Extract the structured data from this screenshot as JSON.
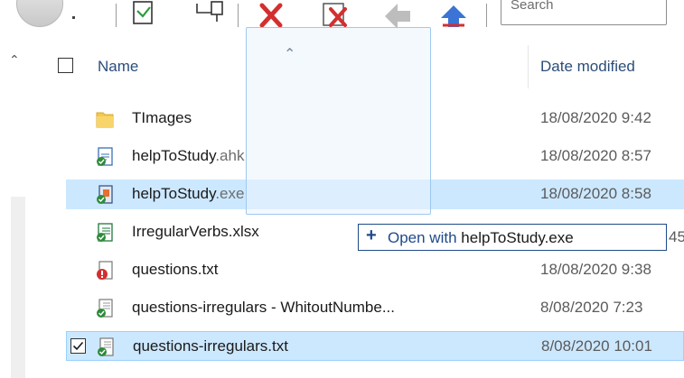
{
  "toolbar": {
    "search_placeholder": "Search",
    "icons": [
      "view-icon",
      "new-file-icon",
      "copy-icon",
      "delete-icon",
      "delete-red-icon",
      "back-icon",
      "forward-icon"
    ]
  },
  "columns": {
    "name": "Name",
    "date_modified": "Date modified"
  },
  "files": [
    {
      "name": "TImages",
      "ext": "",
      "date": "18/08/2020 9:42",
      "icon": "folder-icon",
      "state": "normal"
    },
    {
      "name": "helpToStudy",
      "ext": ".ahk",
      "date": "18/08/2020 8:57",
      "icon": "ahk-script-icon",
      "state": "normal"
    },
    {
      "name": "helpToStudy",
      "ext": ".exe",
      "date": "18/08/2020 8:58",
      "icon": "exe-app-icon",
      "state": "selected"
    },
    {
      "name": "IrregularVerbs.xlsx",
      "ext": "",
      "date": "45",
      "icon": "xlsx-file-icon",
      "state": "normal"
    },
    {
      "name": "questions.txt",
      "ext": "",
      "date": "18/08/2020 9:38",
      "icon": "txt-error-icon",
      "state": "normal"
    },
    {
      "name": "questions-irregulars - WhitoutNumbe...",
      "ext": "",
      "date": "8/08/2020 7:23",
      "icon": "txt-file-icon",
      "state": "normal"
    },
    {
      "name": "questions-irregulars.txt",
      "ext": "",
      "date": "8/08/2020 10:01",
      "icon": "txt-file-icon",
      "state": "checked"
    }
  ],
  "drag_tooltip": {
    "prefix": "Open with",
    "target": "helpToStudy.exe"
  },
  "colors": {
    "selection": "#cce8ff",
    "selection_border": "#99d1ff",
    "tooltip_text": "#1e4a8a",
    "header_text": "#2b4d7a"
  }
}
